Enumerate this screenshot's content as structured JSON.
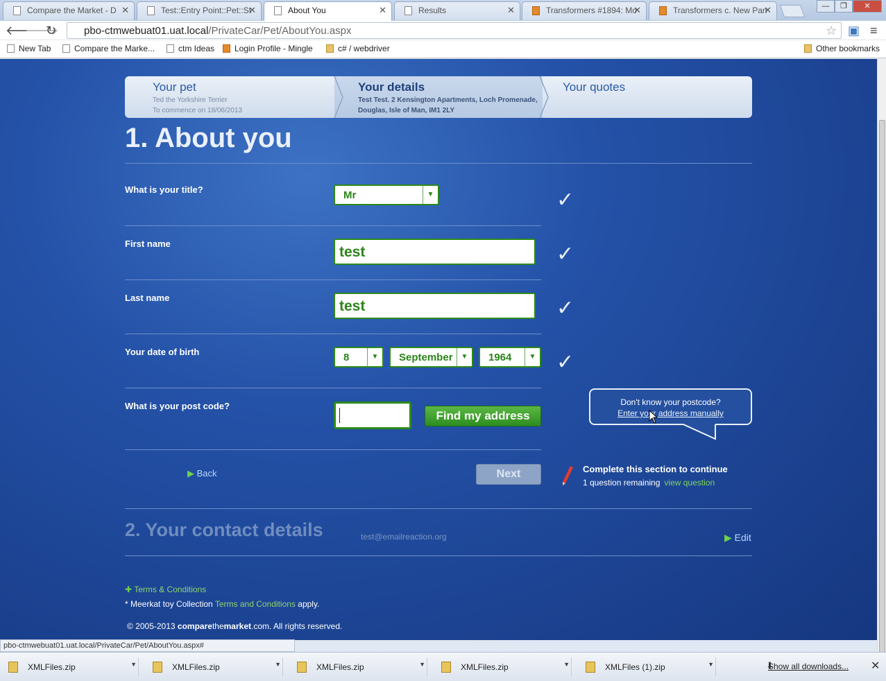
{
  "browser": {
    "tabs": [
      {
        "title": "Compare the Market - D",
        "active": false,
        "favicon": "page-icon"
      },
      {
        "title": "Test::Entry Point::Pet::St",
        "active": false,
        "favicon": "page-icon"
      },
      {
        "title": "About You",
        "active": true,
        "favicon": "page-icon"
      },
      {
        "title": "Results",
        "active": false,
        "favicon": "page-icon"
      },
      {
        "title": "Transformers #1894: Mo",
        "active": false,
        "favicon": "orange-icon"
      },
      {
        "title": "Transformers c. New Pan",
        "active": false,
        "favicon": "orange-icon"
      }
    ],
    "url_host": "pbo-ctmwebuat01.uat.local",
    "url_path": "/PrivateCar/Pet/AboutYou.aspx",
    "bookmarks": [
      {
        "label": "New Tab",
        "icon": "page-icon"
      },
      {
        "label": "Compare the Marke...",
        "icon": "page-icon"
      },
      {
        "label": "ctm Ideas",
        "icon": "bookmark-icon"
      },
      {
        "label": "Login Profile - Mingle",
        "icon": "orange-icon"
      },
      {
        "label": "c# / webdriver",
        "icon": "folder-icon"
      }
    ],
    "other_bookmarks": "Other bookmarks",
    "status_url": "pbo-ctmwebuat01.uat.local/PrivateCar/Pet/AboutYou.aspx#"
  },
  "steps": [
    {
      "title": "Your pet",
      "line1": "Ted the Yorkshire Terrier",
      "line2": "To commence on 18/06/2013"
    },
    {
      "title": "Your details",
      "line1": "Test Test. 2 Kensington Apartments, Loch Promenade,",
      "line2": "Douglas, Isle of Man, IM1 2LY"
    },
    {
      "title": "Your quotes",
      "line1": "",
      "line2": ""
    }
  ],
  "section1": {
    "heading": "1. About you",
    "title_label": "What is your title?",
    "title_value": "Mr",
    "first_name_label": "First name",
    "first_name_value": "test",
    "last_name_label": "Last name",
    "last_name_value": "test",
    "dob_label": "Your date of birth",
    "dob_day": "8",
    "dob_month": "September",
    "dob_year": "1964",
    "postcode_label": "What is your post code?",
    "postcode_value": "",
    "find_button": "Find my address",
    "tip_text": "Don't know your postcode?",
    "tip_link": "Enter your address manually",
    "back_label": "Back",
    "next_label": "Next",
    "complete_text": "Complete this section to continue",
    "remaining_text": "1 question remaining",
    "view_question": "view question"
  },
  "section2": {
    "heading": "2. Your contact details",
    "email": "test@emailreaction.org",
    "edit_label": "Edit"
  },
  "footer": {
    "terms_label": "Terms & Conditions",
    "meerkat_prefix": "* Meerkat toy Collection",
    "meerkat_link": "Terms and Conditions",
    "meerkat_suffix": "apply.",
    "copyright_prefix": "© 2005-2013",
    "brand_compare": "compare",
    "brand_the": "the",
    "brand_market": "market",
    "brand_suffix": ".com. All rights reserved."
  },
  "downloads": {
    "items": [
      "XMLFiles.zip",
      "XMLFiles.zip",
      "XMLFiles.zip",
      "XMLFiles.zip",
      "XMLFiles (1).zip"
    ],
    "show_all": "Show all downloads..."
  }
}
